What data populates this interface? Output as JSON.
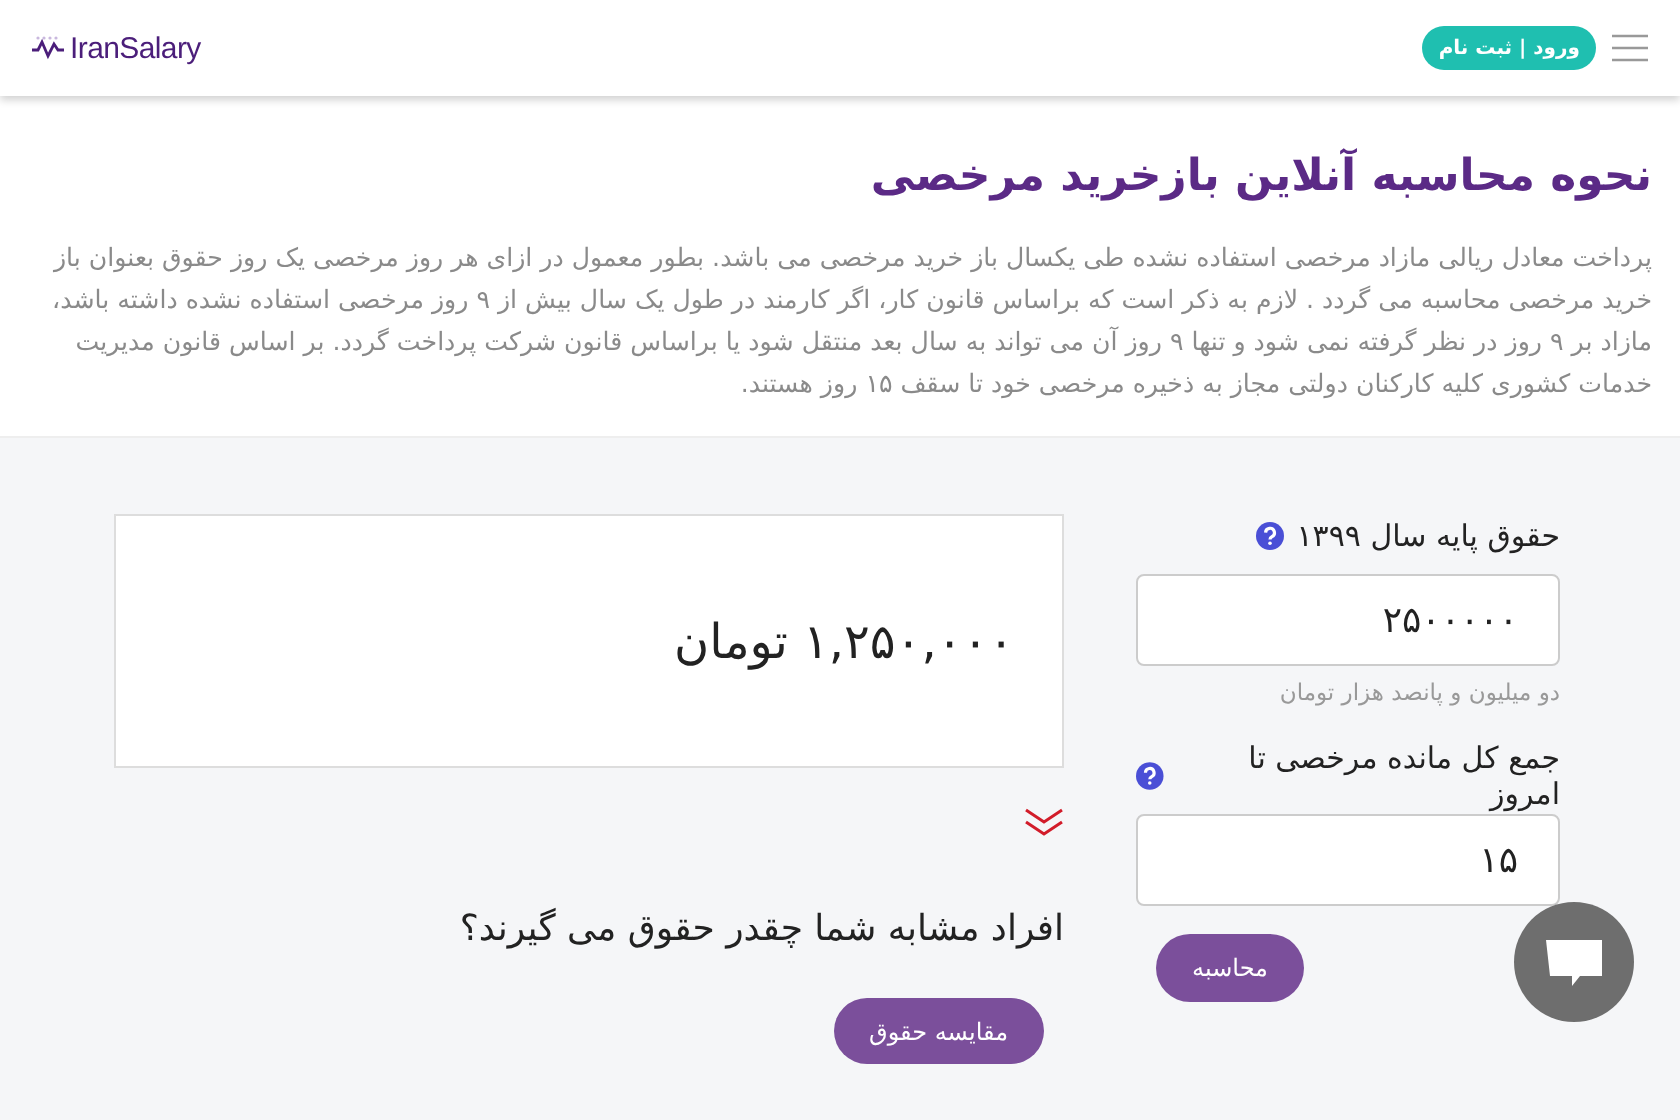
{
  "header": {
    "logo": "IranSalary",
    "auth_button": "ورود | ثبت نام"
  },
  "intro": {
    "title": "نحوه محاسبه آنلاین بازخرید مرخصی",
    "paragraph": "پرداخت معادل ریالی مازاد مرخصی استفاده نشده طی یکسال باز خرید مرخصی می باشد. بطور معمول در ازای هر روز مرخصی یک روز حقوق بعنوان باز خرید مرخصی محاسبه می گردد . لازم به ذکر است که براساس قانون کار، اگر کارمند در طول یک سال بیش از ۹ روز مرخصی استفاده نشده داشته باشد، مازاد بر ۹ روز در نظر گرفته نمی شود و تنها ۹ روز آن می تواند به سال بعد منتقل شود یا براساس قانون شرکت پرداخت گردد. بر اساس قانون مدیریت خدمات کشوری کلیه کارکنان دولتی مجاز به ذخیره مرخصی خود تا سقف ۱۵ روز هستند."
  },
  "form": {
    "fields": [
      {
        "label": "حقوق پایه سال ۱۳۹۹",
        "value": "۲۵۰۰۰۰۰",
        "hint": "دو میلیون و پانصد هزار تومان"
      },
      {
        "label": "جمع کل مانده مرخصی تا امروز",
        "value": "۱۵"
      }
    ],
    "submit": "محاسبه"
  },
  "result": {
    "amount": "۱,۲۵۰,۰۰۰ تومان",
    "question": "افراد مشابه شما چقدر حقوق می گیرند؟",
    "compare_button": "مقایسه حقوق"
  }
}
